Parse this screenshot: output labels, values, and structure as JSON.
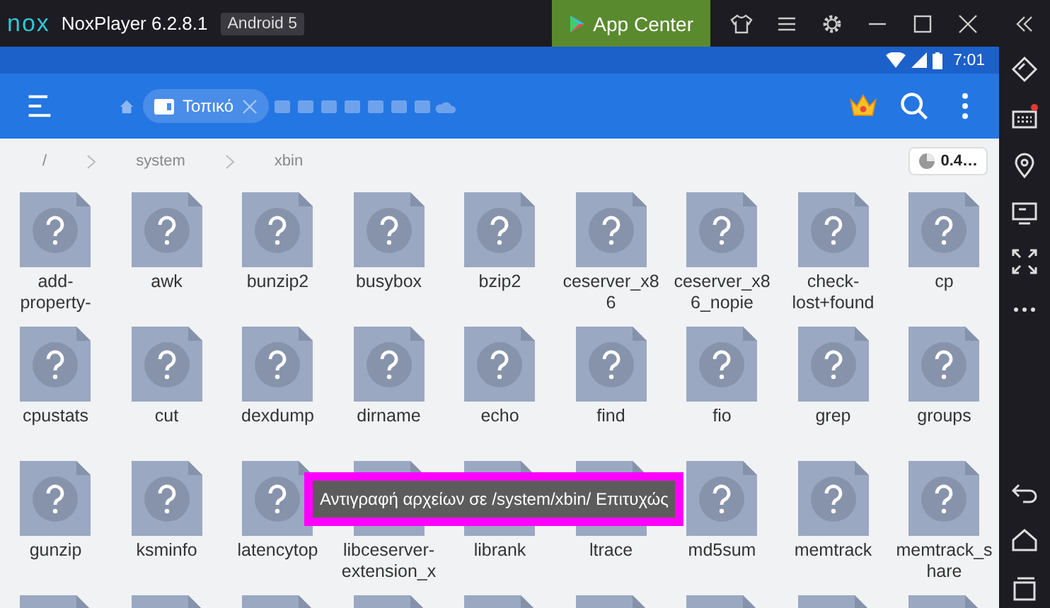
{
  "window": {
    "logo": "nox",
    "title": "NoxPlayer 6.2.8.1",
    "badge": "Android 5",
    "app_center": "App Center"
  },
  "status_bar": {
    "time": "7:01"
  },
  "app_bar": {
    "tab": {
      "label": "Τοπικό",
      "selected": true
    }
  },
  "breadcrumb": [
    "/",
    "system",
    "xbin"
  ],
  "storage": "0.4…",
  "files": [
    {
      "name": "add-property-"
    },
    {
      "name": "awk"
    },
    {
      "name": "bunzip2"
    },
    {
      "name": "busybox"
    },
    {
      "name": "bzip2"
    },
    {
      "name": "ceserver_x86"
    },
    {
      "name": "ceserver_x86_nopie"
    },
    {
      "name": "check-lost+found"
    },
    {
      "name": "cp"
    },
    {
      "name": "cpustats"
    },
    {
      "name": "cut"
    },
    {
      "name": "dexdump"
    },
    {
      "name": "dirname"
    },
    {
      "name": "echo"
    },
    {
      "name": "find"
    },
    {
      "name": "fio"
    },
    {
      "name": "grep"
    },
    {
      "name": "groups"
    },
    {
      "name": "gunzip"
    },
    {
      "name": "ksminfo"
    },
    {
      "name": "latencytop"
    },
    {
      "name": "libceserver-extension_x"
    },
    {
      "name": "librank"
    },
    {
      "name": "ltrace"
    },
    {
      "name": "md5sum"
    },
    {
      "name": "memtrack"
    },
    {
      "name": "memtrack_share"
    }
  ],
  "toast": "Αντιγραφή αρχείων σε /system/xbin/ Επιτυχώς"
}
